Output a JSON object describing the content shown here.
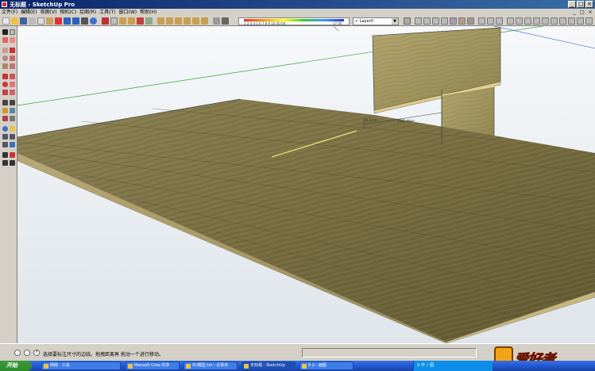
{
  "window": {
    "title": "无标题 - SketchUp Pro",
    "controls": [
      "_",
      "□",
      "×"
    ]
  },
  "menubar": {
    "items": [
      "文件(F)",
      "编辑(E)",
      "视图(V)",
      "相机(C)",
      "绘图(R)",
      "工具(T)",
      "窗口(W)",
      "帮助(H)"
    ],
    "mdi_controls": [
      "_",
      "□",
      "×"
    ]
  },
  "toolbar": {
    "scale_numbers": "1 2 3 4 5 6 7 8 9 10 00:00",
    "scale_end": "17:00",
    "layer_check": "✔",
    "layer_name": "Layer0"
  },
  "viewport": {
    "dimension_labels": [
      "19 2mm",
      "2041 4mm"
    ]
  },
  "statusbar": {
    "message": "选择要标注尺寸的边线。拖拽距离再 拖动一个进行移动。"
  },
  "logo": {
    "text": "爱好者",
    "mark_text": "木工"
  },
  "taskbar": {
    "start_label": "开始",
    "tasks": [
      {
        "label": "网络 · 工具"
      },
      {
        "label": "Maxsoft Crea 共享"
      },
      {
        "label": "SU模型 txt - 记事本"
      },
      {
        "label": "无标题 - SketchUp"
      },
      {
        "label": "9 2 - 画图"
      }
    ],
    "tray_text": "S 中 ♪ 图"
  },
  "colors": {
    "titlebar": "#0a246a",
    "chrome": "#d4d0c8",
    "sky": "#e7ecf0",
    "wood": "#7d7343",
    "taskbar": "#245edb"
  }
}
